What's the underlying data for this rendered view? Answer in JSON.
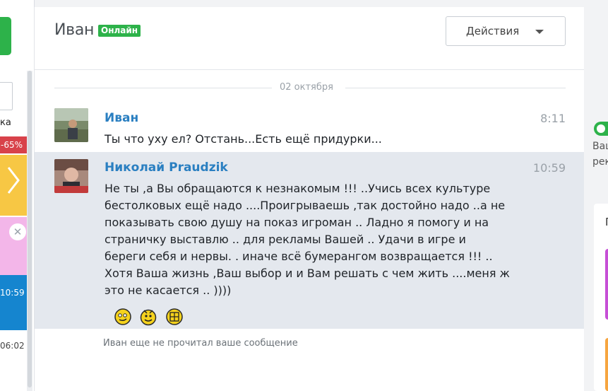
{
  "left_panel": {
    "cut_label": "ка",
    "discount": "-65%",
    "time_active": "10:59",
    "time_other": "06:02"
  },
  "chat": {
    "contact_name": "Иван",
    "status": "Онлайн",
    "actions_label": "Действия",
    "date_separator": "02 октября",
    "messages": [
      {
        "sender": "Иван",
        "time": "8:11",
        "text": "Ты что уху ел? Отстань...Есть ещё придурки..."
      },
      {
        "sender": "Николай Praudzik",
        "time": "10:59",
        "text": "Не ты ,а Вы обращаются к незнакомым !!! ..Учись всех культуре бестолковых ещё надо ....Проигрываешь ,так достойно надо ..а не показывать свою душу на показ игроман .. Ладно я помогу и на страничку выставлю .. для рекламы Вашей .. Удачи в игре и береги себя и нервы. . иначе всё бумерангом возвращается !!! .. Хотя Ваша жизнь ,Ваш выбор и и Вам решать с чем жить ....меня ж это не касается .. ))))",
        "emojis": [
          "smiley-face-icon",
          "smiley-face-icon",
          "smiley-face-icon"
        ]
      }
    ],
    "read_status": "Иван еще не прочитал ваше сообщение"
  },
  "right_panel": {
    "text1": "Ваш",
    "text2": "рек",
    "card_letter": "П"
  },
  "colors": {
    "accent_green": "#2db24a",
    "link_blue": "#2a7fc1",
    "highlight_bg": "#e4e8ee",
    "discount_red": "#d8424a"
  }
}
